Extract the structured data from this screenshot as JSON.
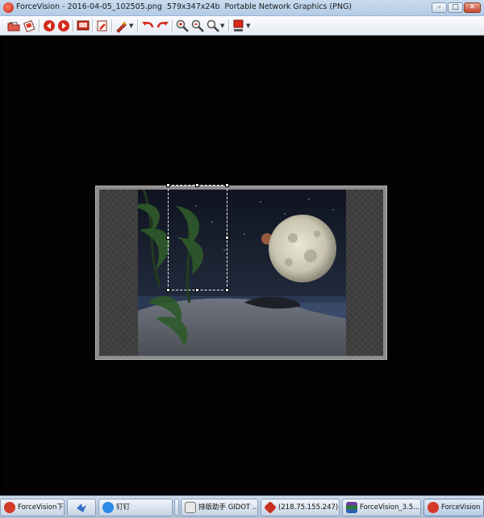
{
  "window": {
    "app_name": "ForceVision",
    "title": "ForceVision - 2016-04-05_102505.png  579x347x24b  Portable Network Graphics (PNG)",
    "controls": [
      "minimize",
      "maximize",
      "close"
    ]
  },
  "toolbar": {
    "buttons": [
      {
        "name": "open-folder-icon"
      },
      {
        "name": "browse-icon"
      },
      {
        "name": "previous-icon"
      },
      {
        "name": "next-icon"
      },
      {
        "name": "slideshow-icon"
      },
      {
        "name": "edit-icon"
      },
      {
        "name": "effects-icon"
      },
      {
        "name": "undo-icon"
      },
      {
        "name": "redo-icon"
      },
      {
        "name": "zoom-in-icon"
      },
      {
        "name": "zoom-out-icon"
      },
      {
        "name": "zoom-options-icon"
      },
      {
        "name": "color-icon"
      }
    ]
  },
  "taskbar": {
    "items": [
      {
        "label": "ForceVision下载..."
      },
      {
        "label": ""
      },
      {
        "label": "钉钉"
      },
      {
        "label": ""
      },
      {
        "label": "排版助手 GIDOT ..."
      },
      {
        "label": "(218.75.155.247)..."
      },
      {
        "label": "ForceVision_3.5...."
      },
      {
        "label": "ForceVision"
      }
    ]
  },
  "colors": {
    "title_bar": "#c9dbef",
    "canvas": "#020202",
    "accent_red": "#c0271a"
  }
}
